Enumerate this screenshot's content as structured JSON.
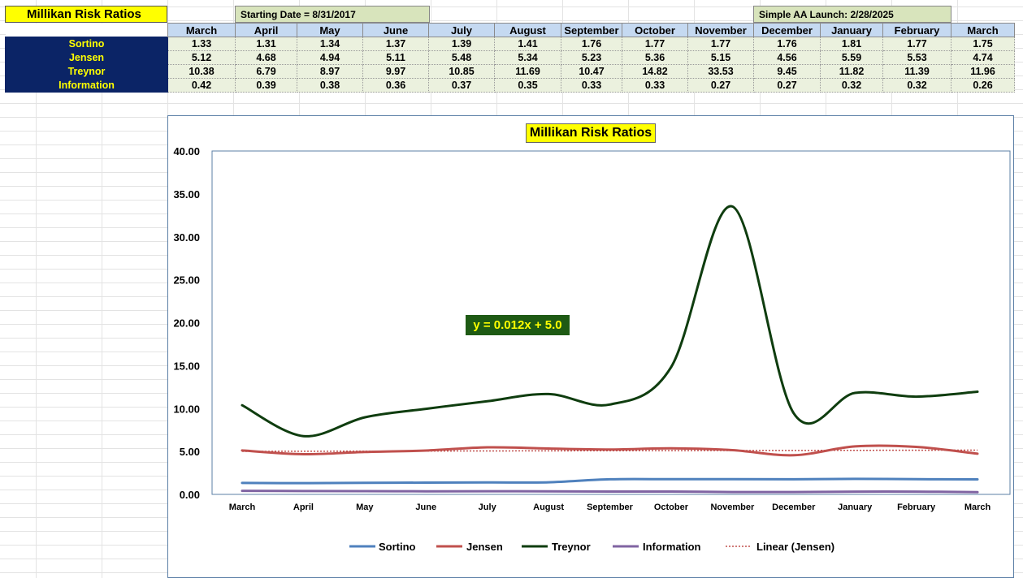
{
  "sheet": {
    "title": "Millikan Risk Ratios",
    "starting_date": "Starting Date = 8/31/2017",
    "launch_note": "Simple AA Launch: 2/28/2025"
  },
  "table": {
    "months": [
      "March",
      "April",
      "May",
      "June",
      "July",
      "August",
      "September",
      "October",
      "November",
      "December",
      "January",
      "February",
      "March"
    ],
    "rows": [
      {
        "label": "Sortino",
        "values": [
          "1.33",
          "1.31",
          "1.34",
          "1.37",
          "1.39",
          "1.41",
          "1.76",
          "1.77",
          "1.77",
          "1.76",
          "1.81",
          "1.77",
          "1.75"
        ]
      },
      {
        "label": "Jensen",
        "values": [
          "5.12",
          "4.68",
          "4.94",
          "5.11",
          "5.48",
          "5.34",
          "5.23",
          "5.36",
          "5.15",
          "4.56",
          "5.59",
          "5.53",
          "4.74"
        ]
      },
      {
        "label": "Treynor",
        "values": [
          "10.38",
          "6.79",
          "8.97",
          "9.97",
          "10.85",
          "11.69",
          "10.47",
          "14.82",
          "33.53",
          "9.45",
          "11.82",
          "11.39",
          "11.96"
        ]
      },
      {
        "label": "Information",
        "values": [
          "0.42",
          "0.39",
          "0.38",
          "0.36",
          "0.37",
          "0.35",
          "0.33",
          "0.33",
          "0.27",
          "0.27",
          "0.32",
          "0.32",
          "0.26"
        ]
      }
    ]
  },
  "chart_data": {
    "type": "line",
    "title": "Millikan Risk Ratios",
    "categories": [
      "March",
      "April",
      "May",
      "June",
      "July",
      "August",
      "September",
      "October",
      "November",
      "December",
      "January",
      "February",
      "March"
    ],
    "ylim": [
      0,
      40
    ],
    "yticks": [
      "0.00",
      "5.00",
      "10.00",
      "15.00",
      "20.00",
      "25.00",
      "30.00",
      "35.00",
      "40.00"
    ],
    "grid": false,
    "legend_position": "bottom",
    "series": [
      {
        "name": "Sortino",
        "color": "#4f81bd",
        "values": [
          1.33,
          1.31,
          1.34,
          1.37,
          1.39,
          1.41,
          1.76,
          1.77,
          1.77,
          1.76,
          1.81,
          1.77,
          1.75
        ]
      },
      {
        "name": "Jensen",
        "color": "#c0504d",
        "values": [
          5.12,
          4.68,
          4.94,
          5.11,
          5.48,
          5.34,
          5.23,
          5.36,
          5.15,
          4.56,
          5.59,
          5.53,
          4.74
        ]
      },
      {
        "name": "Treynor",
        "color": "#0f3d0f",
        "values": [
          10.38,
          6.79,
          8.97,
          9.97,
          10.85,
          11.69,
          10.47,
          14.82,
          33.53,
          9.45,
          11.82,
          11.39,
          11.96
        ]
      },
      {
        "name": "Information",
        "color": "#8064a2",
        "values": [
          0.42,
          0.39,
          0.38,
          0.36,
          0.37,
          0.35,
          0.33,
          0.33,
          0.27,
          0.27,
          0.32,
          0.32,
          0.26
        ]
      }
    ],
    "trendline": {
      "name": "Linear (Jensen)",
      "color": "#c0504d",
      "style": "dotted",
      "equation": "y = 0.012x + 5.0",
      "slope": 0.012,
      "intercept": 5.0
    }
  }
}
